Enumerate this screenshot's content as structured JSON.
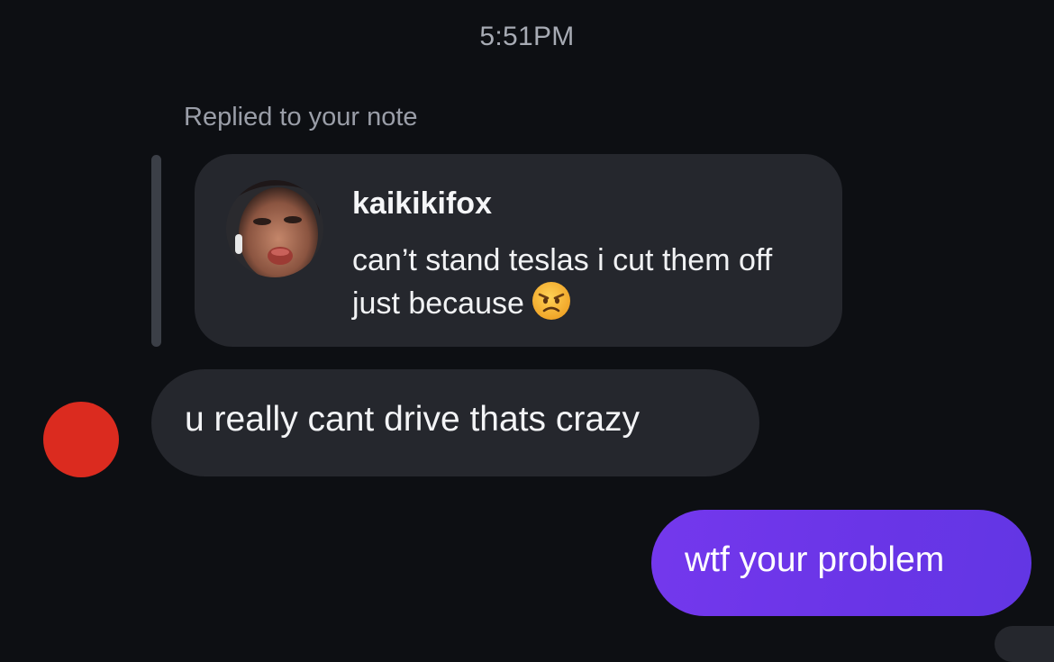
{
  "thread": {
    "timestamp": "5:51PM",
    "reply_context": "Replied to your note"
  },
  "note": {
    "username": "kaikikifox",
    "text": "can’t stand teslas i cut them off just because",
    "emoji_icon": "angry-face-emoji"
  },
  "messages": {
    "incoming": "u really cant drive thats crazy",
    "outgoing": "wtf your problem"
  },
  "colors": {
    "background": "#0d0f13",
    "bubble": "#25272d",
    "outgoing_bubble": "#6c36e8",
    "sender_avatar": "#db2b1f"
  }
}
